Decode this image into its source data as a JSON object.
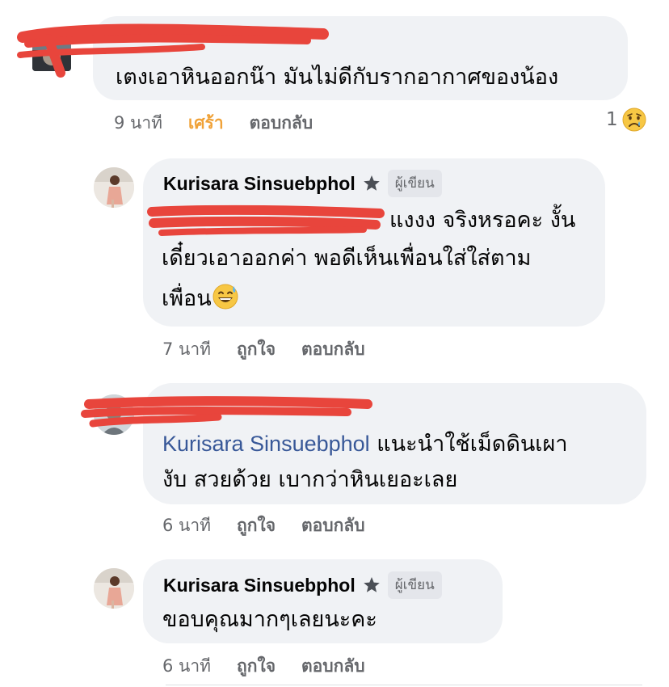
{
  "colors": {
    "bubble_bg": "#f0f2f5",
    "mention_blue": "#385898",
    "meta_gray": "#65676b",
    "reaction_orange": "#f0a238",
    "redaction_red": "#e8453c"
  },
  "comments": [
    {
      "text": "เตงเอาหินออกน๊า มันไม่ดีกับรากอากาศของน้อง",
      "time": "9 นาที",
      "like_label": "เศร้า",
      "reply_label": "ตอบกลับ",
      "reaction_count": "1",
      "reaction_icon": "sad-tear-face-icon"
    },
    {
      "author": "Kurisara Sinsuebphol",
      "author_badge": "ผู้เขียน",
      "text_line1": "แงงง จริงหรอคะ งั้น",
      "text_line2": "เดี๋ยวเอาออกค่า พอดีเห็นเพื่อนใส่ใส่ตาม",
      "text_line3": "เพื่อน",
      "text_emoji": "grinning-sweat-face-icon",
      "time": "7 นาที",
      "like_label": "ถูกใจ",
      "reply_label": "ตอบกลับ"
    },
    {
      "mention": "Kurisara Sinsuebphol",
      "text_line1": "แนะนำใช้เม็ดดินเผา",
      "text_line2": "งับ สวยด้วย เบากว่าหินเยอะเลย",
      "time": "6 นาที",
      "like_label": "ถูกใจ",
      "reply_label": "ตอบกลับ"
    },
    {
      "author": "Kurisara Sinsuebphol",
      "author_badge": "ผู้เขียน",
      "text": "ขอบคุณมากๆเลยนะคะ",
      "time": "6 นาที",
      "like_label": "ถูกใจ",
      "reply_label": "ตอบกลับ"
    }
  ]
}
